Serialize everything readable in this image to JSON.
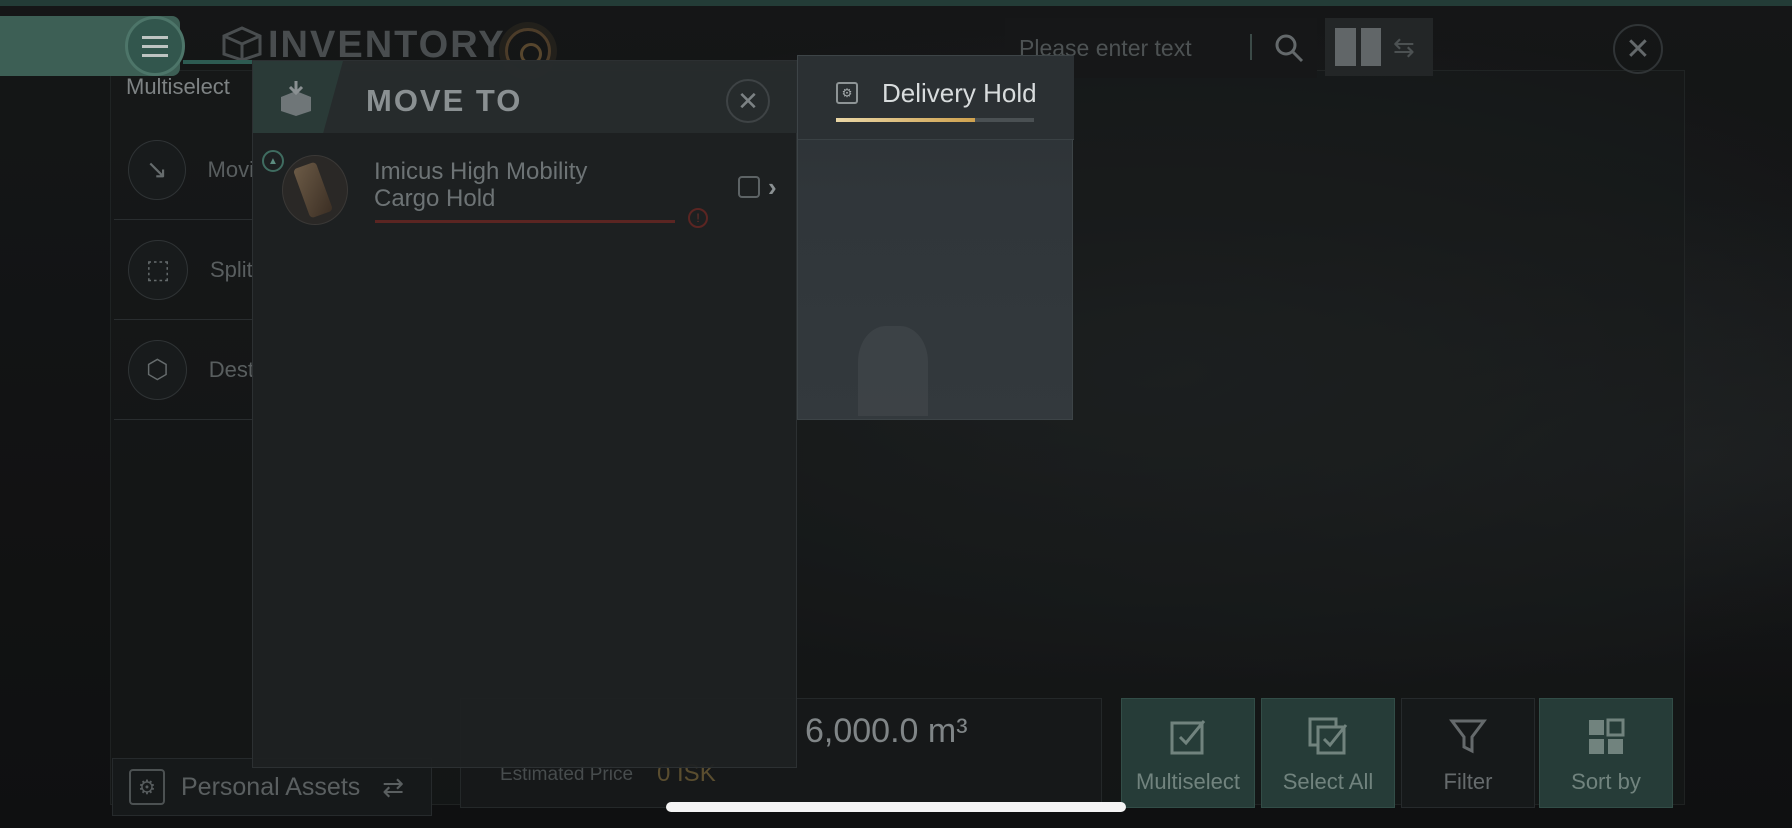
{
  "window": {
    "title": "INVENTORY",
    "close_label": "✕"
  },
  "menu": {
    "icon": "hamburger-menu-icon"
  },
  "multiselect_tab": "Multiselect",
  "side_actions": [
    {
      "label": "Movi",
      "icon": "move-icon"
    },
    {
      "label": "Split",
      "icon": "split-icon"
    },
    {
      "label": "Dest",
      "icon": "destroy-icon"
    }
  ],
  "search": {
    "placeholder": "Please enter text",
    "icon": "search-icon"
  },
  "view_toggle": {
    "icon": "grid-view-icon",
    "swap_icon": "swap-icon"
  },
  "bottom": {
    "assets_label": "Personal Assets",
    "volume": "6,000.0 m³",
    "estimated_price_label": "Estimated Price",
    "estimated_price_value": "0 ISK",
    "buttons": [
      {
        "label": "Multiselect",
        "icon": "checkbox-icon",
        "style": "green"
      },
      {
        "label": "Select All",
        "icon": "select-all-icon",
        "style": "green"
      },
      {
        "label": "Filter",
        "icon": "filter-icon",
        "style": "dark"
      },
      {
        "label": "Sort by",
        "icon": "sort-grid-icon",
        "style": "green"
      }
    ]
  },
  "move_to": {
    "title": "MOVE TO",
    "close_label": "✕",
    "hold": {
      "name_line1": "Imicus High Mobility",
      "name_line2": "Cargo Hold",
      "badge": "▲",
      "warn": "!",
      "chevron": "›"
    }
  },
  "delivery": {
    "title": "Delivery Hold",
    "fill_fraction": 0.7,
    "fill_color": "#cfa24f"
  },
  "colors": {
    "accent_green": "#4b7568",
    "warning_red": "#5b2522",
    "gold": "#cfa24f"
  }
}
